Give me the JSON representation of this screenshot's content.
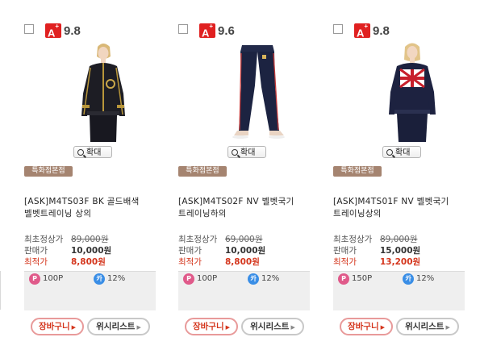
{
  "products": [
    {
      "grade_badge": "A",
      "grade_badge_sup": "+",
      "rating": "9.8",
      "image": "model-black-track-jacket",
      "zoom_label": "확대",
      "store_badge": "특화점본점",
      "name": "[ASK]M4TS03F BK 골드배색 벨벳트레이닝 상의",
      "orig_price_label": "최초정상가",
      "orig_price": "89,000원",
      "sale_price_label": "판매가",
      "sale_price": "10,000원",
      "best_price_label": "최적가",
      "best_price": "8,800원",
      "point_icon": "P",
      "point": "100P",
      "card_icon": "카",
      "card_discount": "12%",
      "cart_label": "장바구니",
      "wishlist_label": "위시리스트"
    },
    {
      "grade_badge": "A",
      "grade_badge_sup": "+",
      "rating": "9.6",
      "image": "navy-velvet-pants",
      "zoom_label": "확대",
      "store_badge": "특화점본점",
      "name": "[ASK]M4TS02F NV 벨벳국기 트레이닝하의",
      "orig_price_label": "최초정상가",
      "orig_price": "69,000원",
      "sale_price_label": "판매가",
      "sale_price": "10,000원",
      "best_price_label": "최적가",
      "best_price": "8,800원",
      "point_icon": "P",
      "point": "100P",
      "card_icon": "카",
      "card_discount": "12%",
      "cart_label": "장바구니",
      "wishlist_label": "위시리스트"
    },
    {
      "grade_badge": "A",
      "grade_badge_sup": "+",
      "rating": "9.8",
      "image": "model-union-jack-jacket",
      "zoom_label": "확대",
      "store_badge": "특화점본점",
      "name": "[ASK]M4TS01F NV 벨벳국기 트레이닝상의",
      "orig_price_label": "최초정상가",
      "orig_price": "89,000원",
      "sale_price_label": "판매가",
      "sale_price": "15,000원",
      "best_price_label": "최적가",
      "best_price": "13,200원",
      "point_icon": "P",
      "point": "150P",
      "card_icon": "카",
      "card_discount": "12%",
      "cart_label": "장바구니",
      "wishlist_label": "위시리스트"
    }
  ],
  "colors": {
    "grade_badge": "#e02020",
    "best_price": "#d4351c",
    "store_badge": "#a58470",
    "point_icon": "#e05a8a",
    "card_icon": "#3a8ee6"
  }
}
